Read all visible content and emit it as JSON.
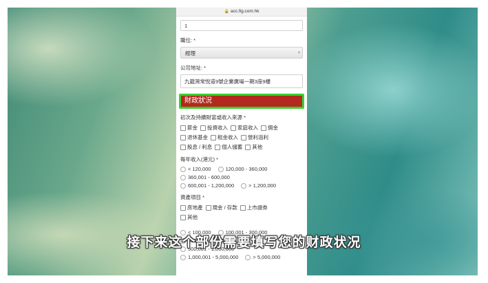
{
  "browser": {
    "url": "acc.fig.com.hk"
  },
  "form": {
    "top_value": "1",
    "position": {
      "label": "職位: *",
      "value": "經理"
    },
    "address": {
      "label": "公司地址: *",
      "value": "九龍灣常悅道9號企業廣場一期3座9樓"
    },
    "section_title": "財政狀況",
    "wealth_source": {
      "label": "初次及持續財富或收入來源 *",
      "rows": [
        [
          "薪金",
          "投資收入",
          "家庭收入",
          "佣金"
        ],
        [
          "退休基金",
          "租金收入",
          "營利溢利"
        ],
        [
          "股息 / 利息",
          "個人儲蓄",
          "其他"
        ]
      ]
    },
    "annual_income": {
      "label": "每年收入(港元) *",
      "rows": [
        [
          "< 120,000",
          "120,000 - 360,000"
        ],
        [
          "360,001 - 600,000"
        ],
        [
          "600,001 - 1,200,000",
          "> 1,200,000"
        ]
      ]
    },
    "assets": {
      "label": "資產項目 *",
      "rows": [
        [
          "房地產",
          "現金 / 存款",
          "上市證券"
        ],
        [
          "其他"
        ]
      ]
    },
    "net_assets": {
      "rows": [
        [
          "< 100,000",
          "100,001 - 300,000"
        ],
        [
          "300,001 - 500,000"
        ],
        [
          "500,001 - 1,000,000"
        ],
        [
          "1,000,001 - 5,000,000",
          "> 5,000,000"
        ]
      ]
    }
  },
  "subtitle": "接下来这个部份需要填写您的财政状况"
}
